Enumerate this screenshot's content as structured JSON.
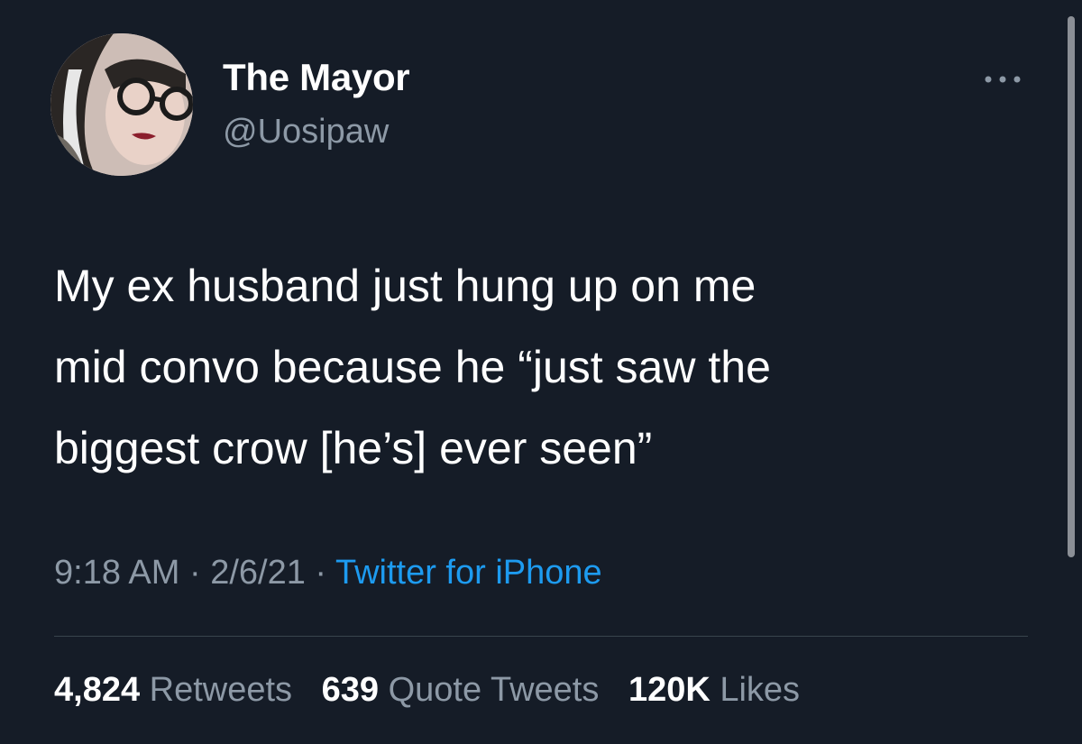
{
  "author": {
    "display_name": "The Mayor",
    "handle": "@Uosipaw",
    "avatar_icon": "profile-photo"
  },
  "menu_icon": "more-horizontal-icon",
  "tweet": {
    "text_lines": [
      "My ex husband just hung up on me",
      "mid convo because he “just saw the",
      "biggest crow [he’s] ever seen”"
    ],
    "time": "9:18 AM",
    "date": "2/6/21",
    "separator": " · ",
    "source": "Twitter for iPhone"
  },
  "stats": {
    "retweets_count": "4,824",
    "retweets_label": "Retweets",
    "quotes_count": "639",
    "quotes_label": "Quote Tweets",
    "likes_count": "120K",
    "likes_label": "Likes"
  },
  "colors": {
    "background": "#151c27",
    "primary_text": "#ffffff",
    "secondary_text": "#8d99a6",
    "link": "#1d9bf0",
    "divider": "#38444d"
  }
}
